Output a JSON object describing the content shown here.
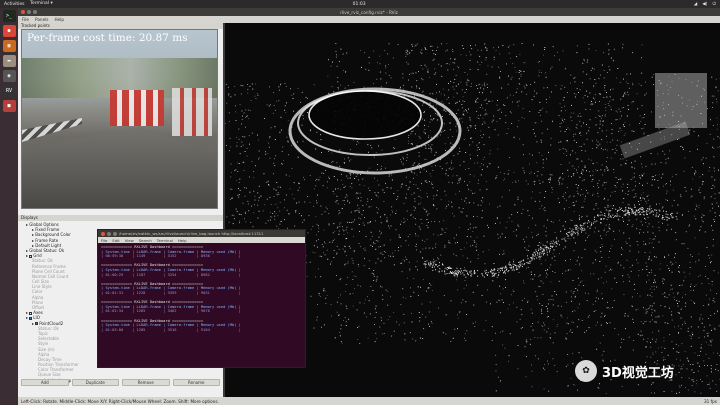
{
  "topbar": {
    "activities": "Activities",
    "app": "Terminal ▾",
    "clock": "01:03"
  },
  "window": {
    "title": "rlive_rviz_config.rviz* - RViz"
  },
  "menu": [
    "File",
    "Panels",
    "Help"
  ],
  "camera_panel": {
    "title": "Tracked points",
    "cost_text": "Per-frame cost time: 20.87 ms"
  },
  "displays_panel": {
    "title": "Displays",
    "rows": [
      {
        "label": "Global Options",
        "indent": 1,
        "dim": false,
        "check": ""
      },
      {
        "label": "Fixed Frame",
        "indent": 2,
        "dim": false,
        "check": ""
      },
      {
        "label": "Background Color",
        "indent": 2,
        "dim": false,
        "check": ""
      },
      {
        "label": "Frame Rate",
        "indent": 2,
        "dim": false,
        "check": ""
      },
      {
        "label": "Default Light",
        "indent": 2,
        "dim": false,
        "check": ""
      },
      {
        "label": "Global Status: Ok",
        "indent": 1,
        "dim": false,
        "check": ""
      },
      {
        "label": "Grid",
        "indent": 1,
        "dim": false,
        "check": "off"
      },
      {
        "label": "Status: Ok",
        "indent": 2,
        "dim": true,
        "check": ""
      },
      {
        "label": "Reference Frame",
        "indent": 2,
        "dim": true,
        "check": ""
      },
      {
        "label": "Plane Cell Count",
        "indent": 2,
        "dim": true,
        "check": ""
      },
      {
        "label": "Normal Cell Count",
        "indent": 2,
        "dim": true,
        "check": ""
      },
      {
        "label": "Cell Size",
        "indent": 2,
        "dim": true,
        "check": ""
      },
      {
        "label": "Line Style",
        "indent": 2,
        "dim": true,
        "check": ""
      },
      {
        "label": "Color",
        "indent": 2,
        "dim": true,
        "check": ""
      },
      {
        "label": "Alpha",
        "indent": 2,
        "dim": true,
        "check": ""
      },
      {
        "label": "Plane",
        "indent": 2,
        "dim": true,
        "check": ""
      },
      {
        "label": "Offset",
        "indent": 2,
        "dim": true,
        "check": ""
      },
      {
        "label": "Axes",
        "indent": 1,
        "dim": false,
        "check": "off"
      },
      {
        "label": "LIO",
        "indent": 1,
        "dim": false,
        "check": "on"
      },
      {
        "label": "PointCloud2",
        "indent": 2,
        "dim": false,
        "check": "on"
      },
      {
        "label": "Status: Ok",
        "indent": 3,
        "dim": true,
        "check": ""
      },
      {
        "label": "Topic",
        "indent": 3,
        "dim": true,
        "check": ""
      },
      {
        "label": "Selectable",
        "indent": 3,
        "dim": true,
        "check": ""
      },
      {
        "label": "Style",
        "indent": 3,
        "dim": true,
        "check": ""
      },
      {
        "label": "Size (m)",
        "indent": 3,
        "dim": true,
        "check": ""
      },
      {
        "label": "Alpha",
        "indent": 3,
        "dim": true,
        "check": ""
      },
      {
        "label": "Decay Time",
        "indent": 3,
        "dim": true,
        "check": ""
      },
      {
        "label": "Position Transformer",
        "indent": 3,
        "dim": true,
        "check": ""
      },
      {
        "label": "Color Transformer",
        "indent": 3,
        "dim": true,
        "check": ""
      },
      {
        "label": "Queue Size",
        "indent": 3,
        "dim": true,
        "check": ""
      },
      {
        "label": "pointcloud_map",
        "indent": 2,
        "dim": false,
        "check": "on"
      }
    ],
    "buttons": [
      "Add",
      "Duplicate",
      "Remove",
      "Rename"
    ]
  },
  "statusbar": {
    "text": "Left-Click: Rotate. Middle-Click: Move X/Y. Right-Click/Mouse Wheel: Zoom. Shift: More options.",
    "right": "31 fps"
  },
  "terminal": {
    "title": "/home/ziv/catkin_ws/src/rlive/launch/rlive_bag.launch http://localhost:11311",
    "menu": [
      "File",
      "Edit",
      "View",
      "Search",
      "Terminal",
      "Help"
    ],
    "blocks": [
      {
        "dash": "============== RXLIVE Dashboard ==============",
        "head": "| System-time | LiDAR-frame | Camera-frame | Memory used (Mb) |",
        "vals": "| 00:59:30    | 1149        | 3152         | 8936             |"
      },
      {
        "dash": "============== RXLIVE Dashboard ==============",
        "head": "| System-time | LiDAR-frame | Camera-frame | Memory used (Mb) |",
        "vals": "| 01:00:29    | 1187        | 3254         | 8982             |"
      },
      {
        "dash": "============== RXLIVE Dashboard ==============",
        "head": "| System-time | LiDAR-frame | Camera-frame | Memory used (Mb) |",
        "vals": "| 01:01:31    | 1228        | 3359         | 9031             |"
      },
      {
        "dash": "============== RXLIVE Dashboard ==============",
        "head": "| System-time | LiDAR-frame | Camera-frame | Memory used (Mb) |",
        "vals": "| 01:02:34    | 1265        | 3462         | 9076             |"
      },
      {
        "dash": "============== RXLIVE Dashboard ==============",
        "head": "| System-time | LiDAR-frame | Camera-frame | Memory used (Mb) |",
        "vals": "| 01:03:00    | 1285        | 3516         | 9104             |"
      }
    ]
  },
  "watermark": {
    "text": "3D视觉工坊"
  },
  "launcher_icons": [
    {
      "name": "terminal-icon",
      "glyph": ">_",
      "color": "#1f2a1f"
    },
    {
      "name": "chrome-icon",
      "glyph": "●",
      "color": "#d8483a"
    },
    {
      "name": "image-viewer-icon",
      "glyph": "▦",
      "color": "#c96a1e"
    },
    {
      "name": "files-icon",
      "glyph": "▬",
      "color": "#9a8f7e"
    },
    {
      "name": "camera-icon",
      "glyph": "◉",
      "color": "#555"
    },
    {
      "name": "rviz-icon",
      "glyph": "RV",
      "color": "#333"
    },
    {
      "name": "app-icon",
      "glyph": "■",
      "color": "#b5403b"
    }
  ]
}
